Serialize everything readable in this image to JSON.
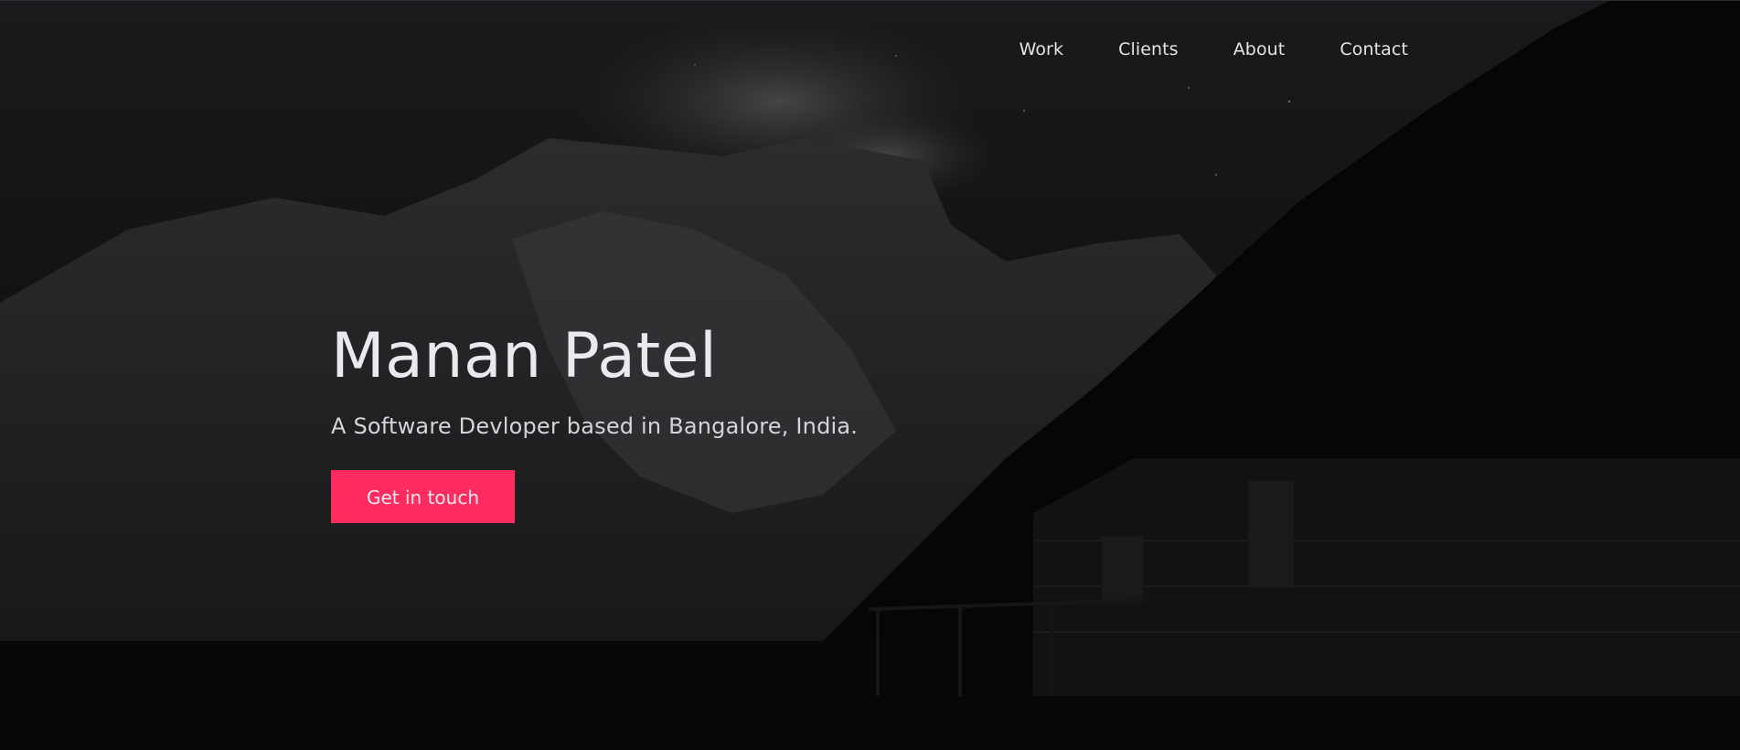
{
  "nav": {
    "items": [
      {
        "label": "Work"
      },
      {
        "label": "Clients"
      },
      {
        "label": "About"
      },
      {
        "label": "Contact"
      }
    ]
  },
  "hero": {
    "title": "Manan Patel",
    "subtitle": "A Software Devloper based in Bangalore, India.",
    "cta_label": "Get in touch"
  },
  "colors": {
    "accent": "#fe2c5e",
    "background": "#0a0a0b",
    "text": "#ece8ef"
  },
  "icons": [
    "background-landscape-image"
  ]
}
